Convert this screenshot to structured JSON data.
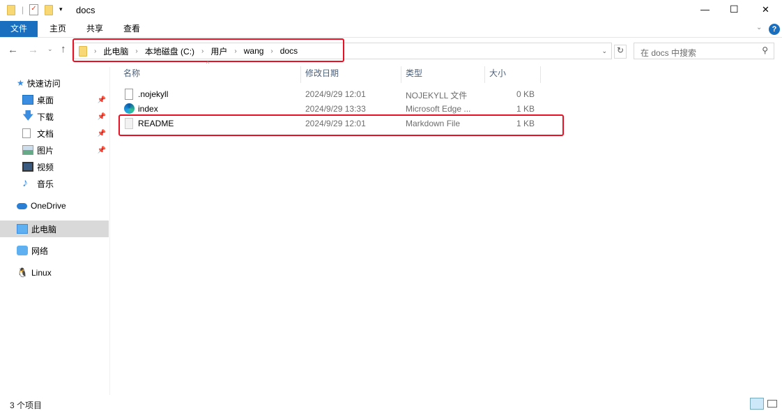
{
  "window": {
    "title": "docs",
    "min": "—",
    "max": "☐",
    "close": "✕"
  },
  "ribbon": {
    "tabs": [
      "文件",
      "主页",
      "共享",
      "查看"
    ]
  },
  "address": {
    "segments": [
      "此电脑",
      "本地磁盘 (C:)",
      "用户",
      "wang",
      "docs"
    ],
    "search_placeholder": "在 docs 中搜索"
  },
  "sidebar": {
    "items": [
      {
        "label": "快速访问"
      },
      {
        "label": "桌面"
      },
      {
        "label": "下载"
      },
      {
        "label": "文档"
      },
      {
        "label": "图片"
      },
      {
        "label": "视频"
      },
      {
        "label": "音乐"
      },
      {
        "label": "OneDrive"
      },
      {
        "label": "此电脑"
      },
      {
        "label": "网络"
      },
      {
        "label": "Linux"
      }
    ]
  },
  "columns": [
    "名称",
    "修改日期",
    "类型",
    "大小"
  ],
  "files": [
    {
      "name": ".nojekyll",
      "date": "2024/9/29 12:01",
      "type": "NOJEKYLL 文件",
      "size": "0 KB"
    },
    {
      "name": "index",
      "date": "2024/9/29 13:33",
      "type": "Microsoft Edge ...",
      "size": "1 KB"
    },
    {
      "name": "README",
      "date": "2024/9/29 12:01",
      "type": "Markdown File",
      "size": "1 KB"
    }
  ],
  "status": {
    "count": "3 个项目"
  }
}
